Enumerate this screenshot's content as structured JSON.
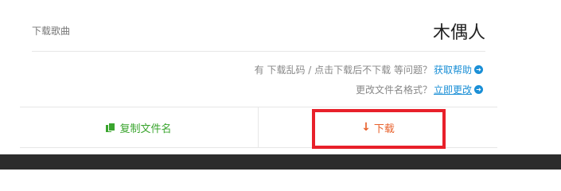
{
  "song": {
    "label": "下载歌曲",
    "name": "木偶人"
  },
  "help": {
    "text": "有 下载乱码 / 点击下载后不下载 等问题？",
    "link": "获取帮助",
    "icon": "circle-arrow-right-icon"
  },
  "rename": {
    "text": "更改文件名格式？",
    "link": "立即更改",
    "icon": "circle-arrow-right-icon"
  },
  "actions": {
    "copy_label": "复制文件名",
    "copy_icon": "copy-icon",
    "copy_color": "#3aa52e",
    "download_label": "下载",
    "download_icon": "arrow-down-icon",
    "download_color": "#e8612c"
  },
  "colors": {
    "link": "#1a8fd6",
    "highlight": "#e8202a",
    "footer_bar": "#2c2c2c"
  }
}
